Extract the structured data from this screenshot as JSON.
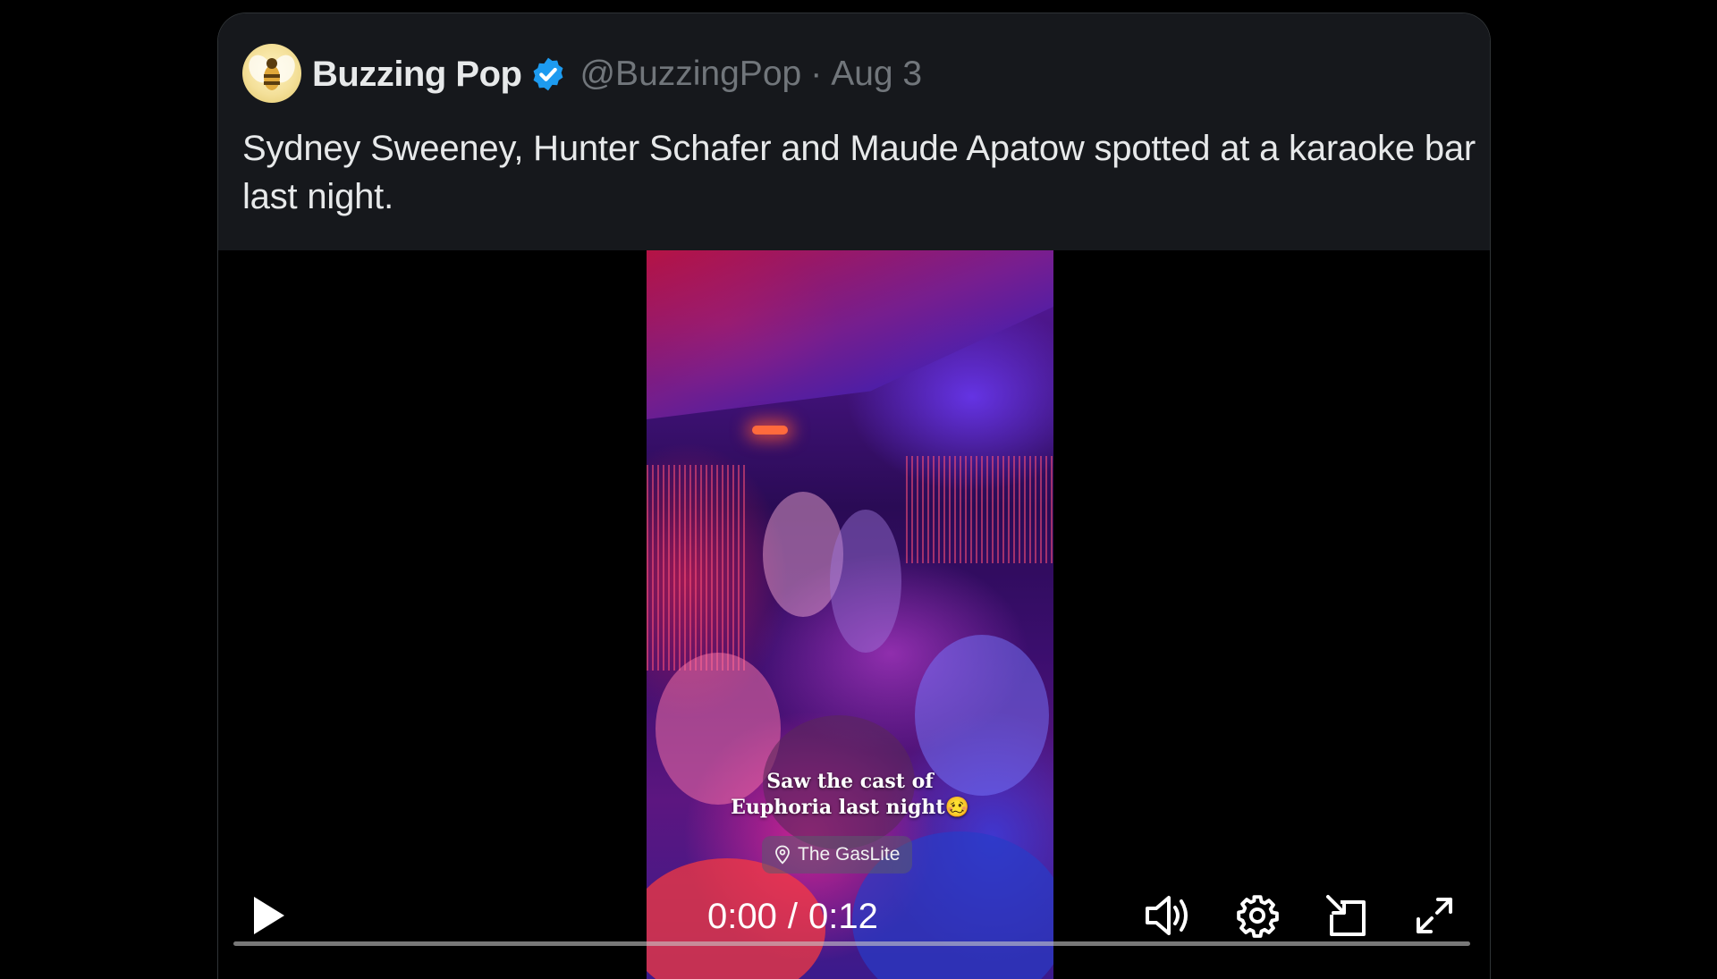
{
  "tweet": {
    "author_name": "Buzzing Pop",
    "handle": "@BuzzingPop",
    "separator": "·",
    "date": "Aug 3",
    "text": "Sydney Sweeney, Hunter Schafer and Maude Apatow spotted at a karaoke bar last night."
  },
  "video": {
    "caption_line1": "Saw the cast of",
    "caption_line2": "Euphoria last night🥴",
    "location": "The GasLite",
    "time_current": "0:00",
    "time_separator": "/",
    "time_total": "0:12",
    "progress_fraction": 0
  },
  "icons": {
    "avatar": "bee-avatar-icon",
    "verified": "verified-badge-icon",
    "pin": "location-pin-icon",
    "play": "play-icon",
    "volume": "volume-icon",
    "settings": "gear-icon",
    "pop_out": "pop-out-icon",
    "fullscreen": "fullscreen-icon"
  },
  "colors": {
    "verified": "#1d9bf0",
    "muted_text": "#71767b",
    "header_bg": "#16181c"
  }
}
